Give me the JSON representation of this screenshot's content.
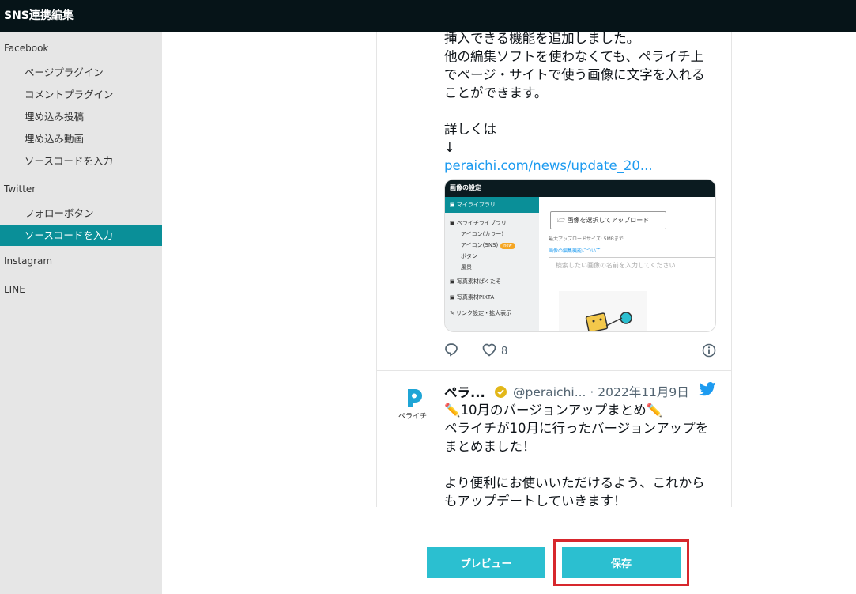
{
  "header": {
    "title": "SNS連携編集"
  },
  "sidebar": {
    "facebook": {
      "label": "Facebook",
      "items": [
        "ページプラグイン",
        "コメントプラグイン",
        "埋め込み投稿",
        "埋め込み動画",
        "ソースコードを入力"
      ]
    },
    "twitter": {
      "label": "Twitter",
      "items": [
        "フォローボタン",
        "ソースコードを入力"
      ],
      "active_index": 1
    },
    "instagram": {
      "label": "Instagram"
    },
    "line": {
      "label": "LINE"
    }
  },
  "tweet1": {
    "lines": [
      "挿入できる機能を追加しました。",
      "他の編集ソフトを使わなくても、ペライチ上",
      "でページ・サイトで使う画像に文字を入れる",
      "ことができます。"
    ],
    "more": "詳しくは",
    "arrow": "↓",
    "link": "peraichi.com/news/update_20...",
    "like_count": "8",
    "card": {
      "title": "画像の設定",
      "left_items": [
        "マイライブラリ",
        "ペライチライブラリ",
        "アイコン(カラー)",
        "アイコン(SNS)",
        "ボタン",
        "風景",
        "写真素材ぱくたそ",
        "写真素材PIXTA",
        "リンク設定・拡大表示"
      ],
      "new_badge": "new",
      "upload_button": "画像を選択してアップロード",
      "max_size": "最大アップロードサイズ: 5MBまで",
      "edit_link": "画像の編集機能について",
      "search_placeholder": "検索したい画像の名前を入力してください"
    }
  },
  "tweet2": {
    "name": "ペラ...",
    "handle_date": "@peraichi... · 2022年11月9日",
    "logo_text": "ペライチ",
    "lines": [
      "✏️10月のバージョンアップまとめ✏️",
      "ペライチが10月に行ったバージョンアップを",
      "まとめました！",
      "",
      "より便利にお使いいただけるよう、これから",
      "もアップデートしていきます！"
    ]
  },
  "buttons": {
    "preview": "プレビュー",
    "save": "保存"
  },
  "colors": {
    "accent": "#2bbfd0",
    "sidebar_active": "#0a8f98",
    "highlight": "#d7272d",
    "twitter_blue": "#1d9bf0"
  }
}
